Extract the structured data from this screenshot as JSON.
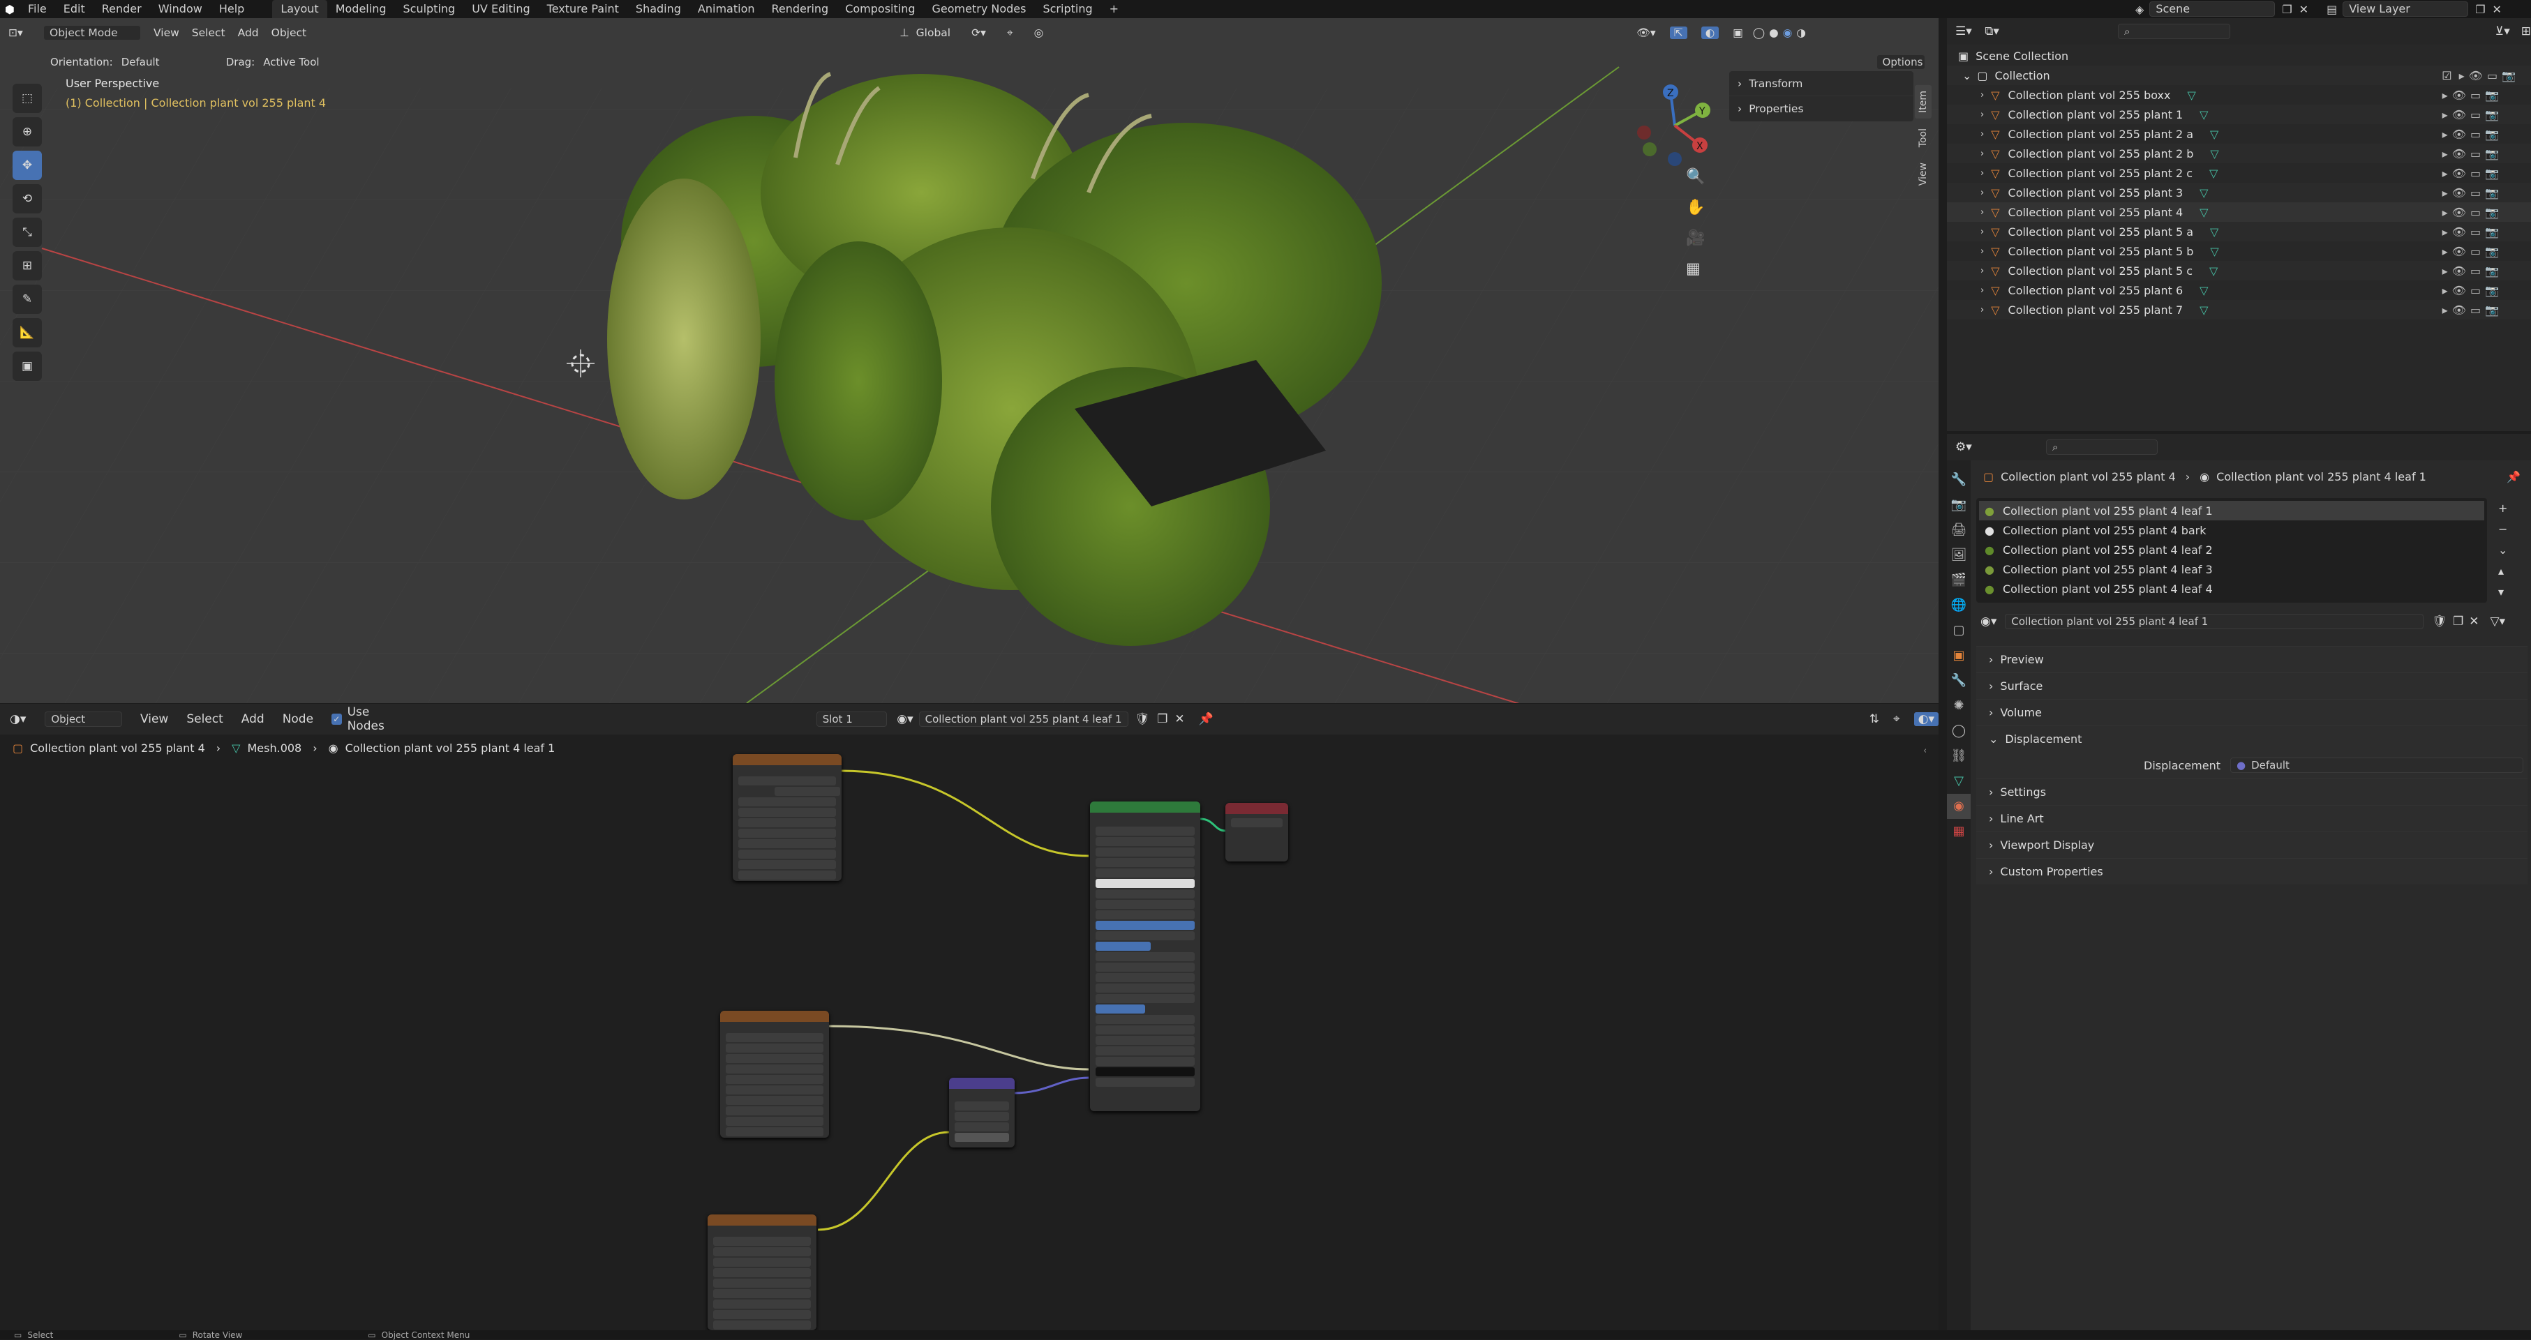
{
  "menu": {
    "items": [
      "File",
      "Edit",
      "Render",
      "Window",
      "Help"
    ]
  },
  "workspaces": [
    "Layout",
    "Modeling",
    "Sculpting",
    "UV Editing",
    "Texture Paint",
    "Shading",
    "Animation",
    "Rendering",
    "Compositing",
    "Geometry Nodes",
    "Scripting"
  ],
  "scene": {
    "name": "Scene",
    "view_layer": "View Layer"
  },
  "viewport": {
    "mode": "Object Mode",
    "menus": [
      "View",
      "Select",
      "Add",
      "Object"
    ],
    "transform_orientation": "Global",
    "orientation_label": "Orientation:",
    "orientation_value": "Default",
    "drag_label": "Drag:",
    "drag_value": "Active Tool",
    "options": "Options",
    "perspective": "User Perspective",
    "collection_info": "(1) Collection | Collection plant vol 255 plant 4",
    "sidebar_panels": [
      "Transform",
      "Properties"
    ],
    "sidebar_tabs": [
      "Item",
      "Tool",
      "View"
    ],
    "gizmo": {
      "z": "Z",
      "y": "Y",
      "x": "X"
    }
  },
  "node_editor": {
    "mode": "Object",
    "menus": [
      "View",
      "Select",
      "Add",
      "Node"
    ],
    "use_nodes": "Use Nodes",
    "slot": "Slot 1",
    "material": "Collection plant vol 255 plant 4 leaf 1",
    "breadcrumb": [
      "Collection plant vol 255 plant 4",
      "Mesh.008",
      "Collection plant vol 255 plant 4 leaf 1"
    ]
  },
  "outliner": {
    "root": "Scene Collection",
    "collection": "Collection",
    "items": [
      "Collection plant vol 255 boxx",
      "Collection plant vol 255 plant 1",
      "Collection plant vol 255 plant 2 a",
      "Collection plant vol 255 plant 2 b",
      "Collection plant vol 255 plant 2 c",
      "Collection plant vol 255 plant 3",
      "Collection plant vol 255 plant 4",
      "Collection plant vol 255 plant 5 a",
      "Collection plant vol 255 plant 5 b",
      "Collection plant vol 255 plant 5 c",
      "Collection plant vol 255 plant 6",
      "Collection plant vol 255 plant 7"
    ]
  },
  "properties": {
    "breadcrumb_object": "Collection plant vol 255 plant 4",
    "breadcrumb_material": "Collection plant vol 255 plant 4 leaf 1",
    "slots": [
      "Collection plant vol 255 plant 4 leaf 1",
      "Collection plant vol 255 plant 4 bark",
      "Collection plant vol 255 plant 4 leaf 2",
      "Collection plant vol 255 plant 4 leaf 3",
      "Collection plant vol 255 plant 4 leaf 4"
    ],
    "material_name": "Collection plant vol 255 plant 4 leaf 1",
    "panels": [
      "Preview",
      "Surface",
      "Volume",
      "Displacement"
    ],
    "displacement_label": "Displacement",
    "displacement_value": "Default",
    "panels_after": [
      "Settings",
      "Line Art",
      "Viewport Display",
      "Custom Properties"
    ]
  },
  "statusbar": {
    "items": [
      "Select",
      "Rotate View",
      "Object Context Menu"
    ]
  },
  "colors": {
    "accent": "#4772b3",
    "active_text": "#e0c060",
    "collection_icon": "#e3843a",
    "mesh_icon": "#47c1a6"
  }
}
